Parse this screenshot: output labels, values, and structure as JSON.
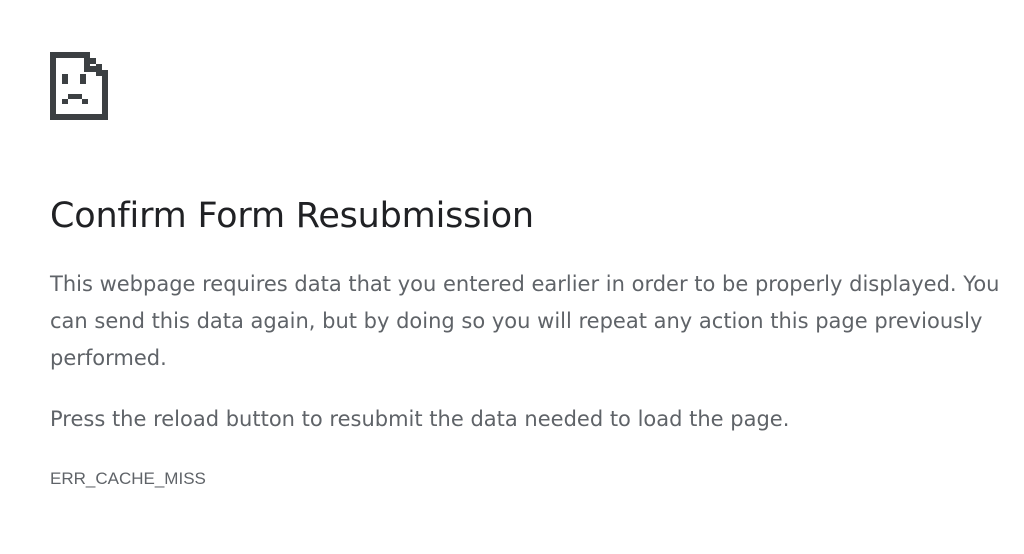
{
  "error_page": {
    "icon": "sad-page-icon",
    "title": "Confirm Form Resubmission",
    "description": "This webpage requires data that you entered earlier in order to be properly displayed. You can send this data again, but by doing so you will repeat any action this page previously performed.",
    "hint": "Press the reload button to resubmit the data needed to load the page.",
    "error_code": "ERR_CACHE_MISS"
  },
  "colors": {
    "title": "#202124",
    "body_text": "#5f6368",
    "icon": "#3c4043",
    "background": "#ffffff"
  }
}
